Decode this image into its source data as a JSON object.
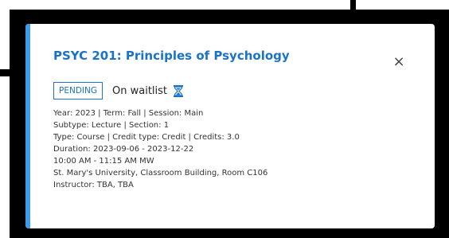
{
  "course": {
    "title": "PSYC 201: Principles of Psychology",
    "close_icon": "×"
  },
  "status": {
    "badge": "PENDING",
    "text": "On waitlist",
    "icon": "hourglass-icon"
  },
  "details": [
    "Year: 2023 | Term: Fall | Session: Main",
    "Subtype: Lecture | Section: 1",
    "Type: Course | Credit type: Credit | Credits: 3.0",
    "Duration: 2023-09-06 - 2023-12-22",
    "10:00 AM - 11:15 AM MW",
    "St. Mary's University, Classroom Building, Room C106",
    "Instructor: TBA, TBA"
  ],
  "colors": {
    "accent": "#3d9be9",
    "title": "#1a73c9",
    "badge": "#1a73c9",
    "frame": "#000000"
  }
}
